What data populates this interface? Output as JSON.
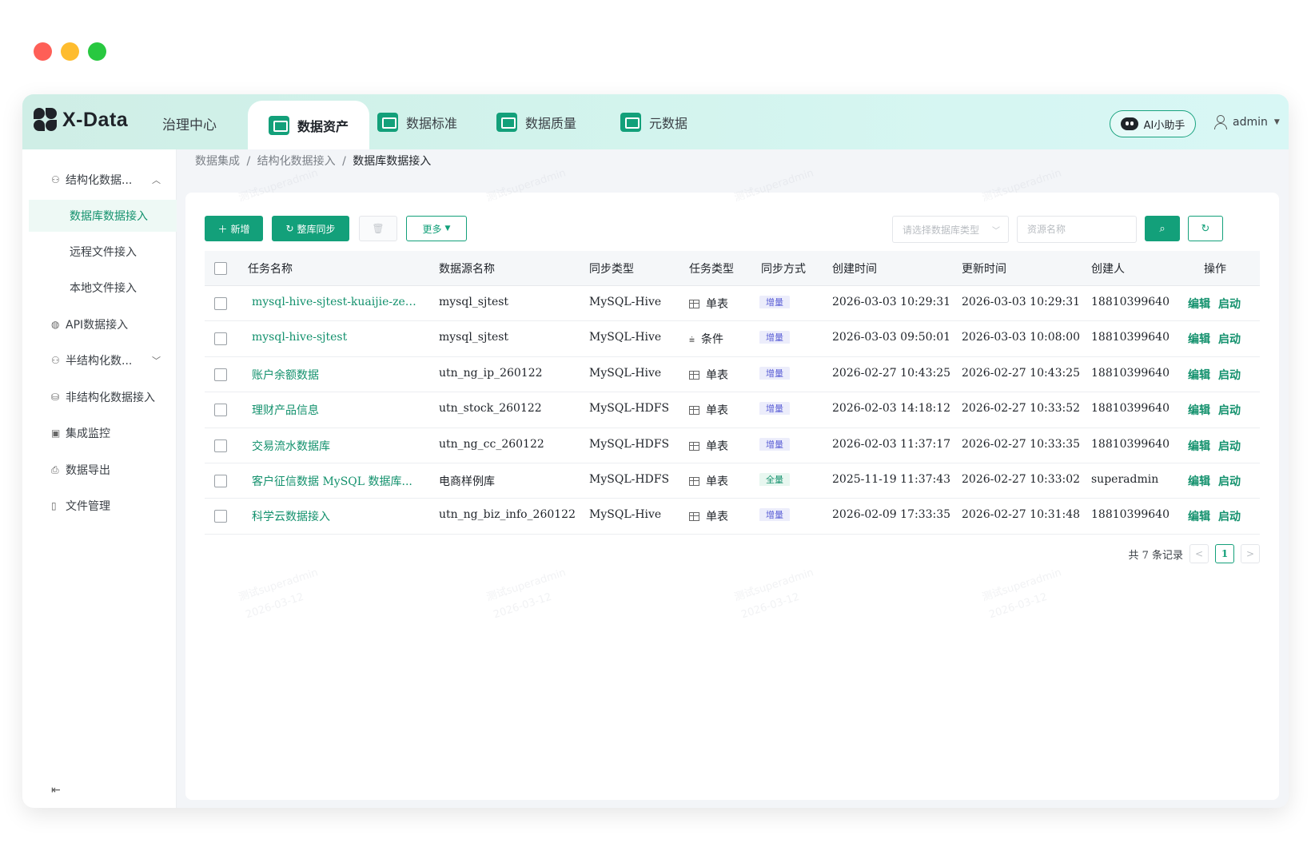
{
  "app": {
    "logo": "X-Data",
    "center": "治理中心"
  },
  "tabs": [
    {
      "label": "数据资产",
      "icon": "wallet-icon",
      "active": true
    },
    {
      "label": "数据标准",
      "icon": "bar-chart-icon"
    },
    {
      "label": "数据质量",
      "icon": "quality-icon"
    },
    {
      "label": "元数据",
      "icon": "metadata-icon"
    }
  ],
  "header": {
    "ai_label": "AI小助手",
    "user": "admin"
  },
  "sidebar": {
    "items": [
      {
        "label": "结构化数据...",
        "icon": "structure-icon",
        "expanded": true
      },
      {
        "label": "数据库数据接入",
        "sub": true,
        "active": true
      },
      {
        "label": "远程文件接入",
        "sub": true
      },
      {
        "label": "本地文件接入",
        "sub": true
      },
      {
        "label": "API数据接入",
        "icon": "api-icon"
      },
      {
        "label": "半结构化数...",
        "icon": "semi-structure-icon",
        "collapsed": true
      },
      {
        "label": "非结构化数据接入",
        "icon": "unstructured-icon"
      },
      {
        "label": "集成监控",
        "icon": "monitor-icon"
      },
      {
        "label": "数据导出",
        "icon": "export-icon"
      },
      {
        "label": "文件管理",
        "icon": "file-icon"
      }
    ]
  },
  "breadcrumb": {
    "level1": "数据集成",
    "level2": "结构化数据接入",
    "current": "数据库数据接入",
    "sep": "/"
  },
  "toolbar": {
    "add_label": "新增",
    "sync_label": "整库同步",
    "more_label": "更多",
    "db_type_placeholder": "请选择数据库类型",
    "name_placeholder": "资源名称"
  },
  "table": {
    "headers": [
      "任务名称",
      "数据源名称",
      "同步类型",
      "任务类型",
      "同步方式",
      "创建时间",
      "更新时间",
      "创建人",
      "操作"
    ],
    "rows": [
      {
        "name": "mysql-hive-sjtest-kuaijie-zengli...",
        "source": "mysql_sjtest",
        "sync_type": "MySQL-Hive",
        "task_type": "单表",
        "mode": "增量",
        "created": "2026-03-03 10:29:31",
        "updated": "2026-03-03 10:29:31",
        "creator": "18810399640"
      },
      {
        "name": "mysql-hive-sjtest",
        "source": "mysql_sjtest",
        "sync_type": "MySQL-Hive",
        "task_type": "条件",
        "mode": "增量",
        "created": "2026-03-03 09:50:01",
        "updated": "2026-03-03 10:08:00",
        "creator": "18810399640"
      },
      {
        "name": "账户余额数据",
        "source": "utn_ng_ip_260122",
        "sync_type": "MySQL-Hive",
        "task_type": "单表",
        "mode": "增量",
        "created": "2026-02-27 10:43:25",
        "updated": "2026-02-27 10:43:25",
        "creator": "18810399640"
      },
      {
        "name": "理财产品信息",
        "source": "utn_stock_260122",
        "sync_type": "MySQL-HDFS",
        "task_type": "单表",
        "mode": "增量",
        "created": "2026-02-03 14:18:12",
        "updated": "2026-02-27 10:33:52",
        "creator": "18810399640"
      },
      {
        "name": "交易流水数据库",
        "source": "utn_ng_cc_260122",
        "sync_type": "MySQL-HDFS",
        "task_type": "单表",
        "mode": "增量",
        "created": "2026-02-03 11:37:17",
        "updated": "2026-02-27 10:33:35",
        "creator": "18810399640"
      },
      {
        "name": "客户征信数据 MySQL 数据库...",
        "source": "电商样例库",
        "sync_type": "MySQL-HDFS",
        "task_type": "单表",
        "mode": "全量",
        "created": "2025-11-19 11:37:43",
        "updated": "2026-02-27 10:33:02",
        "creator": "superadmin"
      },
      {
        "name": "科学云数据接入",
        "source": "utn_ng_biz_info_260122",
        "sync_type": "MySQL-Hive",
        "task_type": "单表",
        "mode": "增量",
        "created": "2026-02-09 17:33:35",
        "updated": "2026-02-27 10:31:48",
        "creator": "18810399640"
      }
    ],
    "edit_label": "编辑",
    "start_label": "启动"
  },
  "pagination": {
    "total_text": "共 7 条记录",
    "current": "1",
    "prev": "<",
    "next": ">"
  },
  "watermark": {
    "user": "测试superadmin",
    "date": "2026-03-12"
  },
  "colors": {
    "accent": "#13a07a",
    "link": "#13916d",
    "tag_incremental": "#5b5fd6"
  }
}
